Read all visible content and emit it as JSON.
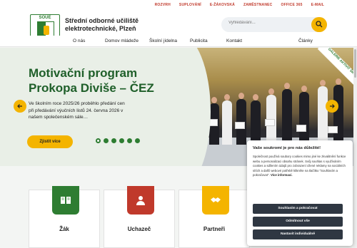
{
  "topbar": {
    "links": [
      "ROZVRH",
      "SUPLOVÁNÍ",
      "E-ŽÁKOVSKÁ",
      "ZAMĚSTNANEC",
      "OFFICE 365",
      "E-MAIL"
    ]
  },
  "logo": {
    "text": "SOUE",
    "name": "school-logo"
  },
  "header": {
    "school_name": "Střední odborné učiliště elektrotechnické, Plzeň"
  },
  "search": {
    "placeholder": "Vyhledávání...",
    "icon": "search-icon"
  },
  "nav": {
    "items": [
      "O nás",
      "Domov mládeže",
      "Školní jídelna",
      "Publicita",
      "Kontakt",
      "Články"
    ]
  },
  "hero": {
    "title": "Motivační program Prokopa Diviše – ČEZ",
    "text": "Ve školním roce 2025/26 proběhlo předání cen při předávání výučních listů 24. června 2026 v našem společenském sále…",
    "cta": "Zjistit více",
    "ribbon": "GALERIE AKTIVIT ŠKOLY",
    "slides": 6,
    "active_slide": 1
  },
  "cards": [
    {
      "label": "Žák",
      "color": "#2e7d32",
      "icon": "book-icon"
    },
    {
      "label": "Uchazeč",
      "color": "#c0392b",
      "icon": "person-icon"
    },
    {
      "label": "Partneři",
      "color": "#f4b400",
      "icon": "handshake-icon"
    }
  ],
  "cookie": {
    "title": "Vaše soukromí je pro nás důležité!",
    "body_a": "Společnost používá soubory cookies mimo jiné ke zkvalitnění funkce webu a personalizaci obsahu stránek. Svůj souhlas s využíváním cookies a sdílením údajů pro zobrazení cílené reklamy na sociálních sítích a další webové potřebě klikněte na tlačítko \"Souhlasím a pokračovat\".",
    "body_link": "Více informací.",
    "accept": "Souhlasím a pokračovat",
    "reject": "Odmítnout vše",
    "custom": "Nastavit individuálně"
  },
  "colors": {
    "green": "#2e7d32",
    "red": "#c0392b",
    "yellow": "#f4b400"
  }
}
